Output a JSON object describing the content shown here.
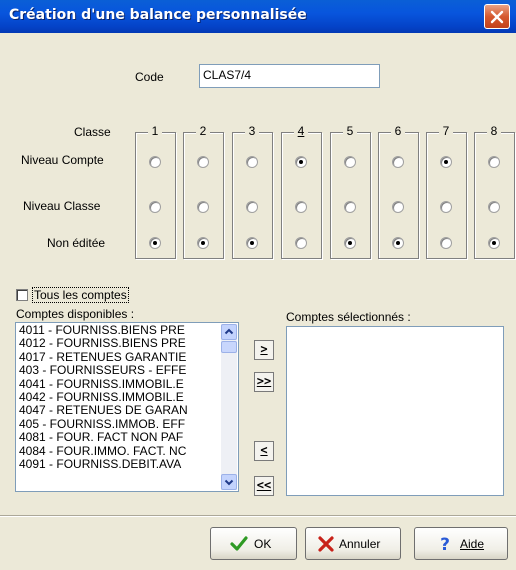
{
  "window": {
    "title": "Création d'une balance personnalisée"
  },
  "code": {
    "label": "Code",
    "value": "CLAS7/4"
  },
  "grid": {
    "header_label": "Classe",
    "rows": [
      "Niveau Compte",
      "Niveau Classe",
      "Non éditée"
    ],
    "columns": [
      {
        "title": "1",
        "selected": "Non éditée"
      },
      {
        "title": "2",
        "selected": "Non éditée"
      },
      {
        "title": "3",
        "selected": "Non éditée"
      },
      {
        "title": "4",
        "selected": "Niveau Compte"
      },
      {
        "title": "5",
        "selected": "Non éditée"
      },
      {
        "title": "6",
        "selected": "Non éditée"
      },
      {
        "title": "7",
        "selected": "Niveau Compte"
      },
      {
        "title": "8",
        "selected": "Non éditée"
      }
    ],
    "active_column": "4"
  },
  "all_accounts": {
    "label": "Tous les comptes",
    "checked": false
  },
  "available": {
    "label": "Comptes disponibles :",
    "items": [
      "4011 - FOURNISS.BIENS PRE",
      "4012 - FOURNISS.BIENS PRE",
      "4017 - RETENUES GARANTIE",
      "403 - FOURNISSEURS - EFFE",
      "4041 - FOURNISS.IMMOBIL.E",
      "4042 - FOURNISS.IMMOBIL.E",
      "4047 - RETENUES DE GARAN",
      "405 - FOURNISS.IMMOB. EFF",
      "4081 - FOUR. FACT NON PAF",
      "4084 - FOUR.IMMO. FACT. NC",
      "4091 - FOURNISS.DEBIT.AVA"
    ]
  },
  "selected": {
    "label": "Comptes sélectionnés :",
    "items": []
  },
  "move_buttons": {
    "add": ">",
    "add_all": ">>",
    "remove": "<",
    "remove_all": "<<"
  },
  "buttons": {
    "ok": "OK",
    "cancel": "Annuler",
    "help": "Aide"
  },
  "colors": {
    "title_bar": "#0855dd",
    "dialog_bg": "#ece9d8",
    "close_button": "#d6592f",
    "ok_check": "#2e9a24",
    "cancel_x": "#c8221a",
    "help_mark": "#2a5bd7"
  },
  "icons": {
    "close": "close-icon",
    "ok": "check-icon",
    "cancel": "x-icon",
    "help": "question-icon"
  }
}
